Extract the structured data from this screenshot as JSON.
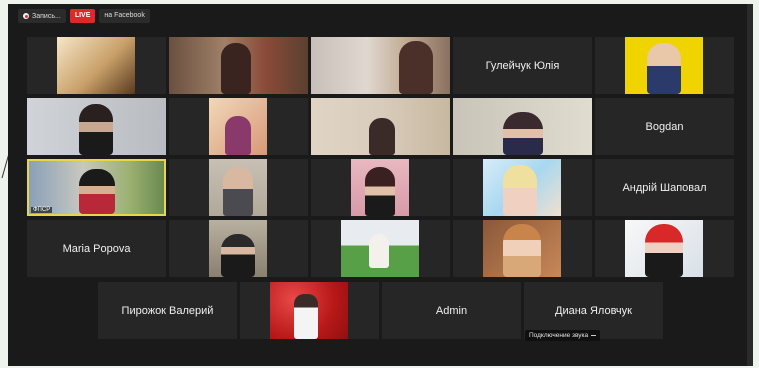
{
  "toolbar": {
    "record_label": "Запись...",
    "live_label": "LIVE",
    "facebook_label": "на Facebook"
  },
  "participants": {
    "yuliia": "Гулейчук Юлія",
    "bogdan": "Bogdan",
    "andrii": "Андрій Шаповал",
    "maria": "Maria Popova",
    "valerii": "Пирожок Валерий",
    "admin": "Admin",
    "diana": "Диана Яловчук"
  },
  "badge": {
    "text": "ФПСР"
  },
  "status": {
    "text": "Подключение звука"
  },
  "colors": {
    "live": "#e02828",
    "active_speaker_border": "#e8d64a",
    "tile_background": "#262626"
  }
}
